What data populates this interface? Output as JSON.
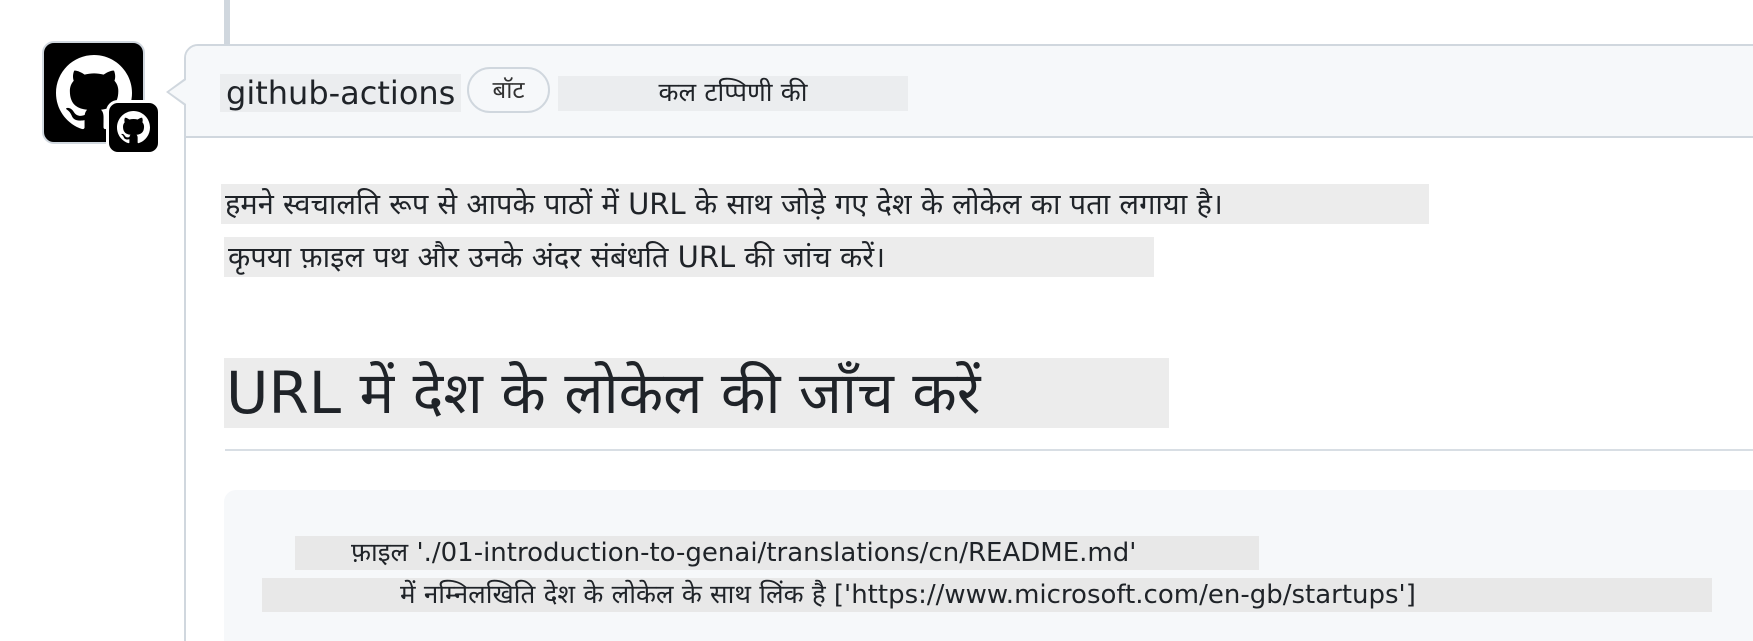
{
  "comment": {
    "author": "github-actions",
    "bot_badge": "बॉट",
    "timestamp": "कल टप्पिणी की"
  },
  "body": {
    "paragraph_line1": "हमने स्वचालति रूप से आपके पाठों में URL के साथ जोड़े गए देश के लोकेल का पता लगाया है।",
    "paragraph_line2": "कृपया फ़ाइल पथ और उनके अंदर संबंधति URL की जांच करें।",
    "heading": "URL में देश के लोकेल की जाँच करें",
    "code_line1": "फ़ाइल './01-introduction-to-genai/translations/cn/README.md'",
    "code_line2": "में नम्निलखिति देश के लोकेल के साथ लिंक है ['https://www.microsoft.com/en-gb/startups']"
  },
  "icons": {
    "avatar": "github-octocat-icon",
    "avatar_badge": "github-octocat-icon"
  },
  "colors": {
    "border": "#d0d7de",
    "header_bg": "#f6f8fa",
    "highlight_bg": "#ececec"
  }
}
